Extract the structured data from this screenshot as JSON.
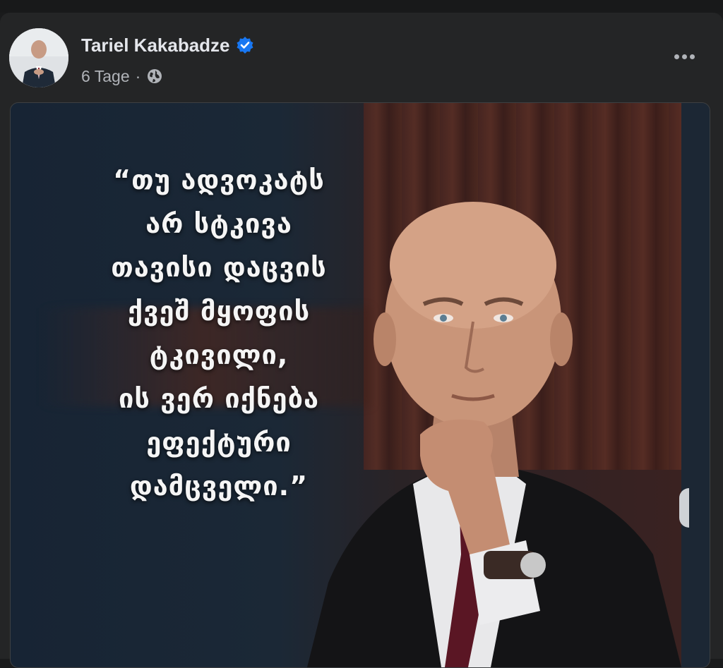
{
  "post": {
    "author": {
      "name": "Tariel Kakabadze",
      "verified": true,
      "avatar_icon": "profile-photo"
    },
    "timestamp": "6 Tage",
    "separator": "·",
    "audience_icon": "globe-icon",
    "menu_icon": "more-options-icon"
  },
  "image": {
    "quote": "“თუ ადვოკატს\nარ სტკივა\nთავისი დაცვის\nქვეშ მყოფის\nტკივილი,\nის ვერ იქნება\nეფექტური\nდამცველი.”",
    "photo_subject": "bald man in dark suit and burgundy tie, chin resting on hand"
  },
  "colors": {
    "background": "#242526",
    "name_text": "#e4e6eb",
    "secondary_text": "#b0b3b8",
    "verified_blue": "#1877f2"
  }
}
